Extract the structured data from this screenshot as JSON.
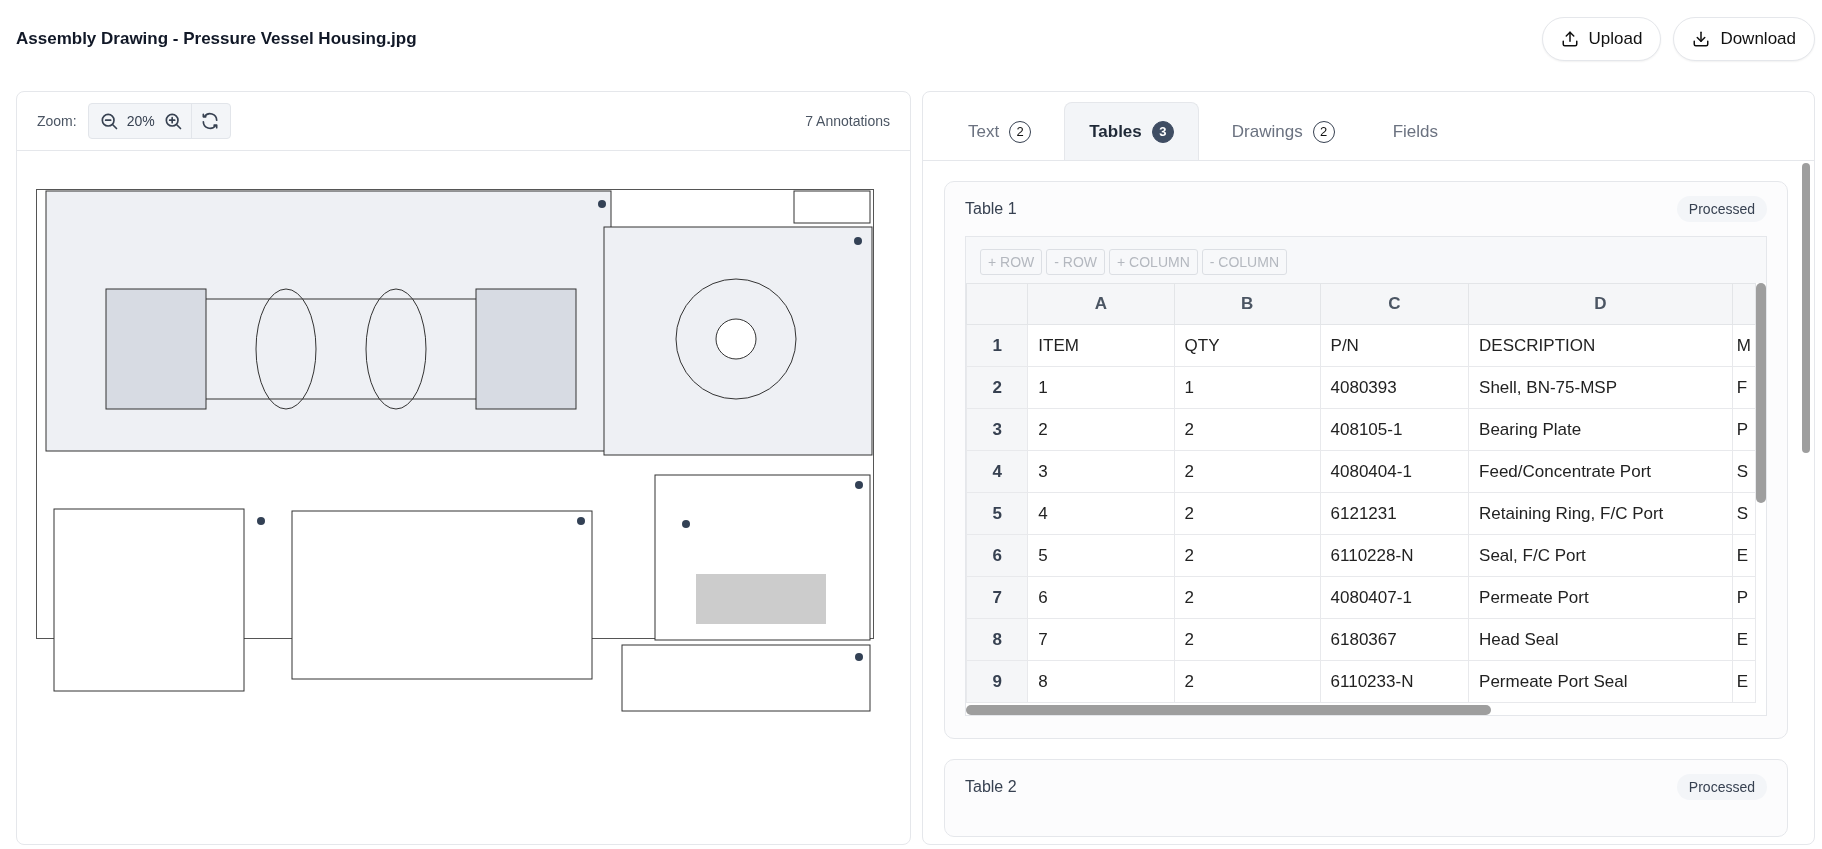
{
  "document": {
    "title": "Assembly Drawing - Pressure Vessel Housing.jpg"
  },
  "actions": [
    {
      "label": "Upload",
      "kind": "upload"
    },
    {
      "label": "Download",
      "kind": "download"
    }
  ],
  "viewer": {
    "zoom_label": "Zoom:",
    "zoom_value": "20%",
    "annotation_count": "7 Annotations"
  },
  "tabs": [
    {
      "label": "Text",
      "count": "2",
      "selected": false
    },
    {
      "label": "Tables",
      "count": "3",
      "selected": true
    },
    {
      "label": "Drawings",
      "count": "2",
      "selected": false
    },
    {
      "label": "Fields",
      "selected": false
    }
  ],
  "tables": [
    {
      "title": "Table 1",
      "status": "Processed",
      "toolbar": [
        {
          "label": "+ ROW",
          "disabled": true
        },
        {
          "label": "- ROW",
          "disabled": true
        },
        {
          "label": "+ COLUMN",
          "disabled": true
        },
        {
          "label": "- COLUMN",
          "disabled": true
        }
      ],
      "columns": [
        "",
        "A",
        "B",
        "C",
        "D"
      ],
      "rows": [
        [
          "1",
          "ITEM",
          "QTY",
          "P/N",
          "DESCRIPTION",
          "M"
        ],
        [
          "2",
          "1",
          "1",
          "4080393",
          "Shell, BN-75-MSP",
          "F"
        ],
        [
          "3",
          "2",
          "2",
          "408105-1",
          "Bearing Plate",
          "P"
        ],
        [
          "4",
          "3",
          "2",
          "4080404-1",
          "Feed/Concentrate Port",
          "S"
        ],
        [
          "5",
          "4",
          "2",
          "6121231",
          "Retaining Ring, F/C Port",
          "S"
        ],
        [
          "6",
          "5",
          "2",
          "6110228-N",
          "Seal, F/C Port",
          "E"
        ],
        [
          "7",
          "6",
          "2",
          "4080407-1",
          "Permeate Port",
          "P"
        ],
        [
          "8",
          "7",
          "2",
          "6180367",
          "Head Seal",
          "E"
        ],
        [
          "9",
          "8",
          "2",
          "6110233-N",
          "Permeate Port Seal",
          "E"
        ]
      ]
    },
    {
      "title": "Table 2",
      "status": "Processed"
    }
  ]
}
